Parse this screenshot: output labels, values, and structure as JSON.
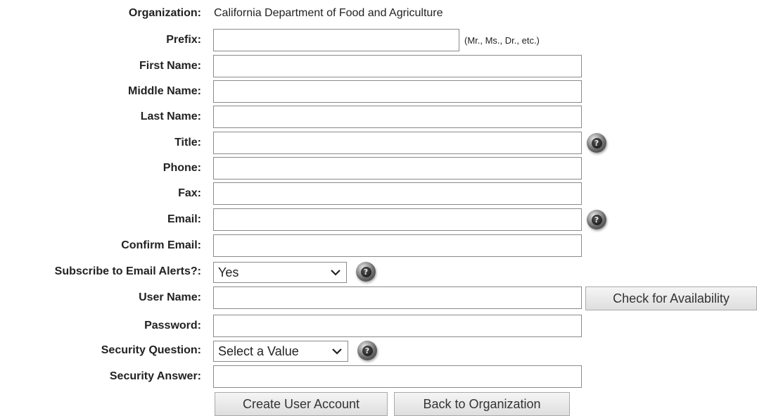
{
  "organization": {
    "label": "Organization:",
    "value": "California Department of Food and Agriculture"
  },
  "fields": {
    "prefix": {
      "label": "Prefix:",
      "value": "",
      "hint": "(Mr., Ms., Dr., etc.)"
    },
    "first_name": {
      "label": "First Name:",
      "value": ""
    },
    "middle_name": {
      "label": "Middle Name:",
      "value": ""
    },
    "last_name": {
      "label": "Last Name:",
      "value": ""
    },
    "title": {
      "label": "Title:",
      "value": ""
    },
    "phone": {
      "label": "Phone:",
      "value": ""
    },
    "fax": {
      "label": "Fax:",
      "value": ""
    },
    "email": {
      "label": "Email:",
      "value": ""
    },
    "confirm_email": {
      "label": "Confirm Email:",
      "value": ""
    },
    "subscribe": {
      "label": "Subscribe to Email Alerts?:",
      "selected": "Yes"
    },
    "user_name": {
      "label": "User Name:",
      "value": ""
    },
    "password": {
      "label": "Password:",
      "value": ""
    },
    "security_question": {
      "label": "Security Question:",
      "selected": "Select a Value"
    },
    "security_answer": {
      "label": "Security Answer:",
      "value": ""
    }
  },
  "buttons": {
    "check_availability": "Check for Availability",
    "create_account": "Create User Account",
    "back_to_org": "Back to Organization"
  },
  "icons": {
    "help": "help-icon",
    "dropdown": "chevron-down-icon"
  }
}
